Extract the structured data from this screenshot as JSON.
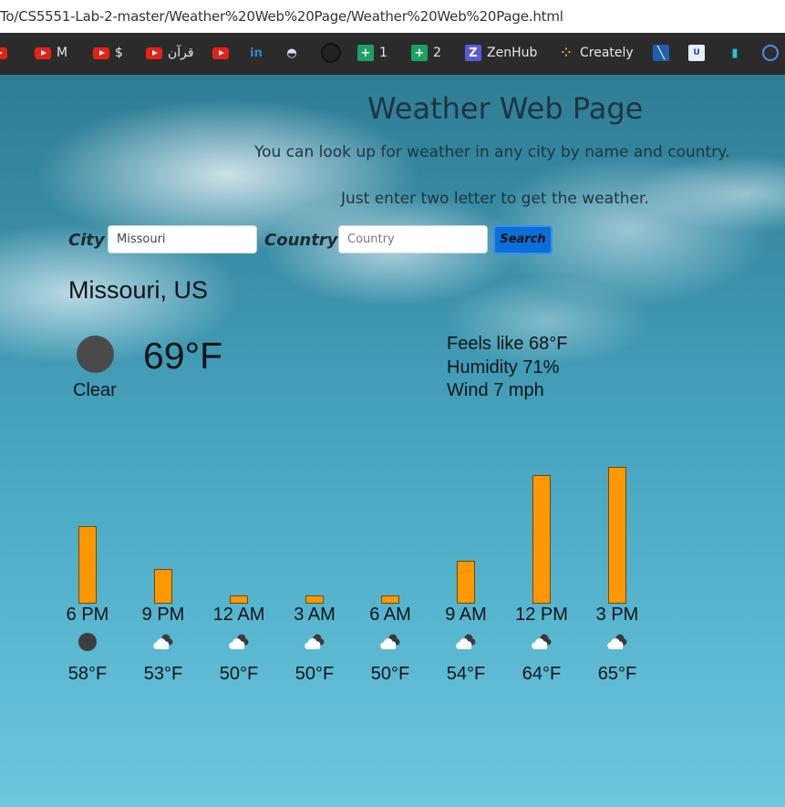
{
  "browser": {
    "url": "To/CS5551-Lab-2-master/Weather%20Web%20Page/Weather%20Web%20Page.html",
    "bookmarks": [
      {
        "icon": "youtube-icon",
        "label": ""
      },
      {
        "icon": "youtube-icon",
        "label": "M"
      },
      {
        "icon": "youtube-icon",
        "label": "$"
      },
      {
        "icon": "youtube-icon",
        "label": "قرآن"
      },
      {
        "icon": "youtube-icon",
        "label": ""
      },
      {
        "icon": "linkedin-icon",
        "label": ""
      },
      {
        "icon": "dashboard-icon",
        "label": ""
      },
      {
        "icon": "github-icon",
        "label": ""
      },
      {
        "icon": "sheets-icon",
        "label": "1"
      },
      {
        "icon": "sheets-icon",
        "label": "2"
      },
      {
        "icon": "zenhub-icon",
        "label": "ZenHub"
      },
      {
        "icon": "creately-icon",
        "label": "Creately"
      },
      {
        "icon": "flag-icon",
        "label": ""
      },
      {
        "icon": "umkc-icon",
        "label": ""
      },
      {
        "icon": "analytics-icon",
        "label": ""
      },
      {
        "icon": "circle-icon",
        "label": ""
      }
    ]
  },
  "page": {
    "title": "Weather Web Page",
    "subtitle1": "You can look up for weather in any city by name and country.",
    "subtitle2": "Just enter two letter to get the weather."
  },
  "search": {
    "city_label": "City",
    "city_value": "Missouri",
    "country_label": "Country",
    "country_placeholder": "Country",
    "button_label": "Search"
  },
  "current": {
    "location": "Missouri, US",
    "temperature": "69°F",
    "condition": "Clear",
    "condition_icon": "clear-night-icon",
    "feels_like": "Feels like 68°F",
    "humidity": "Humidity 71%",
    "wind": "Wind 7 mph"
  },
  "forecast": [
    {
      "time": "6 PM",
      "temp": "58°F",
      "value": 58,
      "icon": "clear-night-icon"
    },
    {
      "time": "9 PM",
      "temp": "53°F",
      "value": 53,
      "icon": "partly-cloudy-icon"
    },
    {
      "time": "12 AM",
      "temp": "50°F",
      "value": 50,
      "icon": "partly-cloudy-icon"
    },
    {
      "time": "3 AM",
      "temp": "50°F",
      "value": 50,
      "icon": "partly-cloudy-icon"
    },
    {
      "time": "6 AM",
      "temp": "50°F",
      "value": 50,
      "icon": "partly-cloudy-icon"
    },
    {
      "time": "9 AM",
      "temp": "54°F",
      "value": 54,
      "icon": "partly-cloudy-icon"
    },
    {
      "time": "12 PM",
      "temp": "64°F",
      "value": 64,
      "icon": "partly-cloudy-icon"
    },
    {
      "time": "3 PM",
      "temp": "65°F",
      "value": 65,
      "icon": "partly-cloudy-icon"
    }
  ],
  "colors": {
    "bar": "#ff9800",
    "button": "#0a6fd8",
    "icon_dark": "#4a4a4a"
  }
}
